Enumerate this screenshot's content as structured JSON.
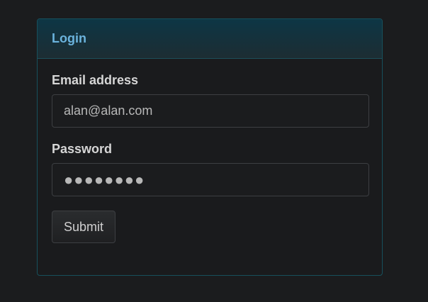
{
  "panel": {
    "title": "Login"
  },
  "form": {
    "email": {
      "label": "Email address",
      "value": "alan@alan.com"
    },
    "password": {
      "label": "Password",
      "value": "●●●●●●●●"
    },
    "submit_label": "Submit"
  },
  "colors": {
    "title": "#6bb3dd",
    "panel_border": "#17505c",
    "background": "#1b1c1e"
  }
}
